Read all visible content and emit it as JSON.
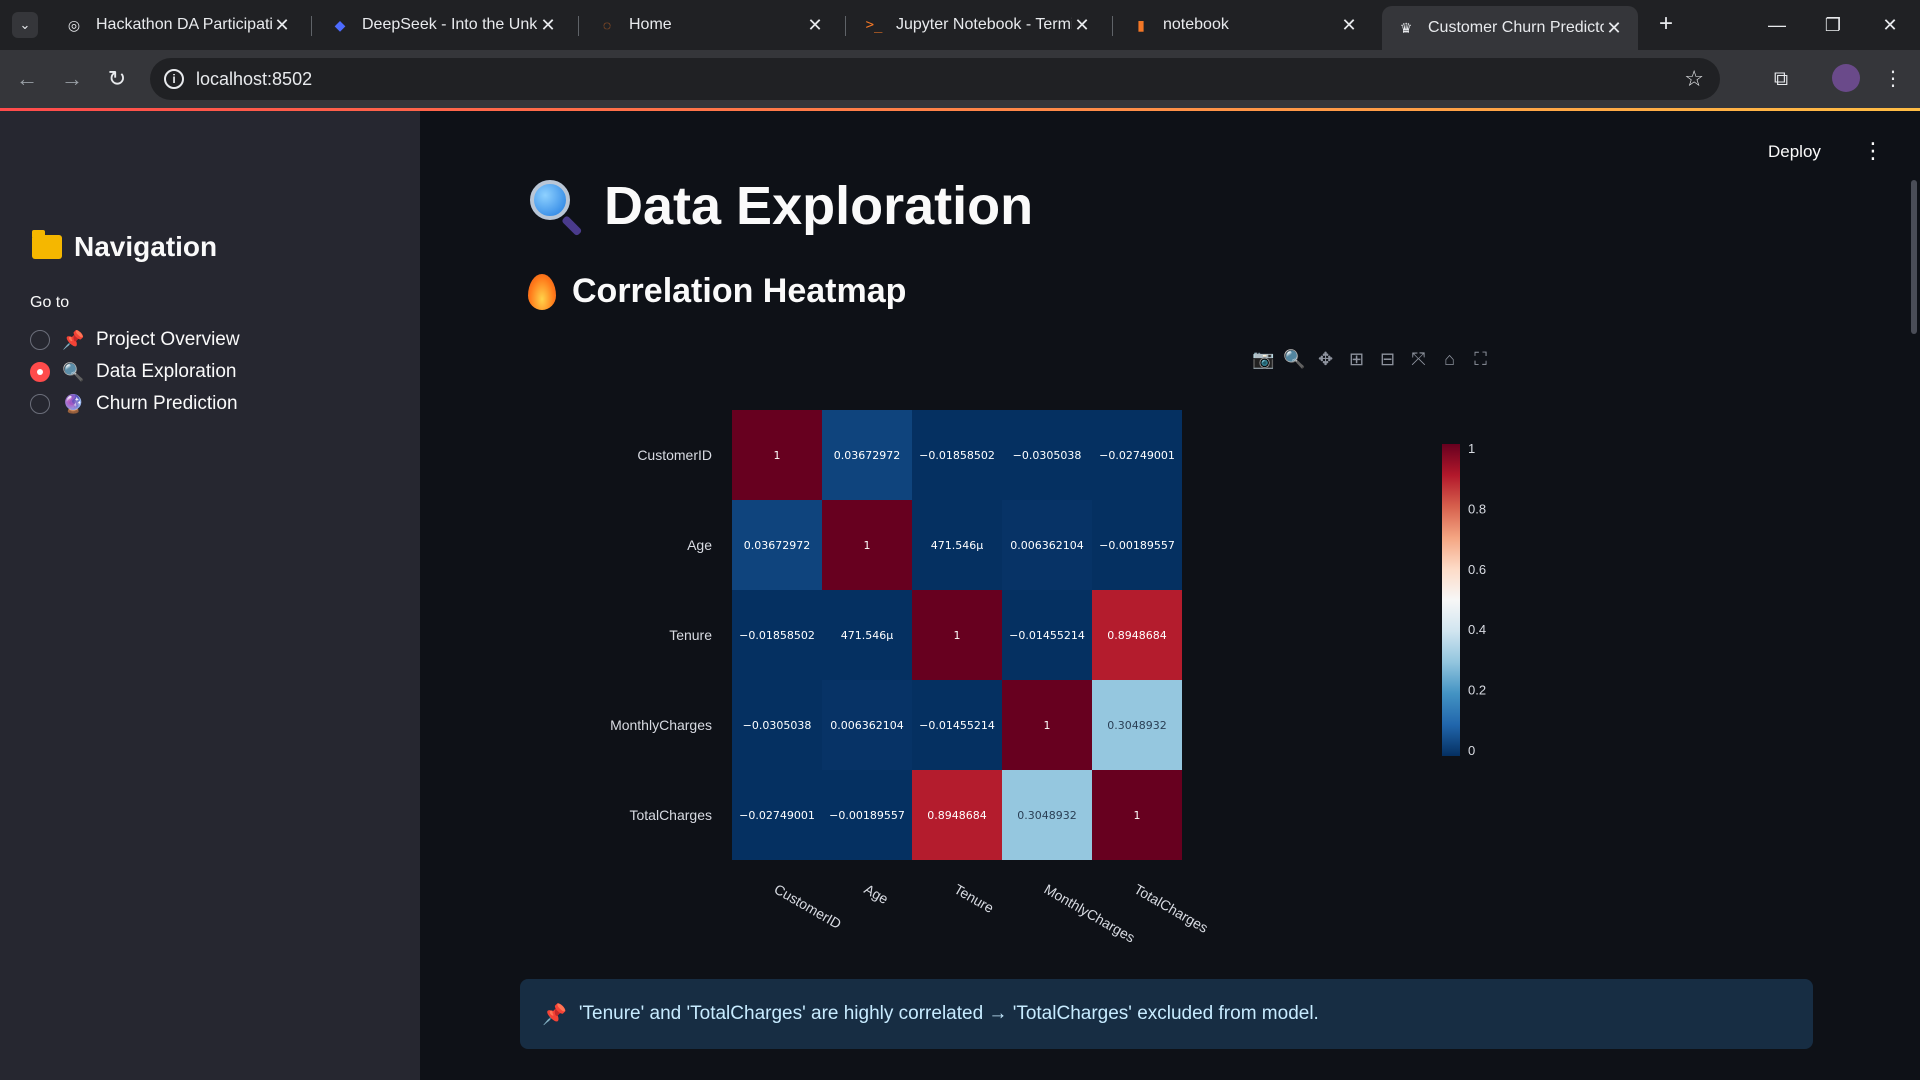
{
  "browser": {
    "tabs": [
      {
        "title": "Hackathon DA Participatio",
        "icon": "openai-icon"
      },
      {
        "title": "DeepSeek - Into the Unkno",
        "icon": "deepseek-icon"
      },
      {
        "title": "Home",
        "icon": "jupyter-icon"
      },
      {
        "title": "Jupyter Notebook - Termin",
        "icon": "terminal-icon"
      },
      {
        "title": "notebook",
        "icon": "notebook-icon"
      },
      {
        "title": "Customer Churn Predictor",
        "icon": "streamlit-icon",
        "active": true
      }
    ],
    "url": "localhost:8502"
  },
  "sidebar": {
    "heading": "Navigation",
    "goto_label": "Go to",
    "items": [
      {
        "label": "Project Overview",
        "emoji": "📌",
        "selected": false
      },
      {
        "label": "Data Exploration",
        "emoji": "🔍",
        "selected": true
      },
      {
        "label": "Churn Prediction",
        "emoji": "🔮",
        "selected": false
      }
    ]
  },
  "header": {
    "deploy_label": "Deploy"
  },
  "main": {
    "title": "Data Exploration",
    "section_title": "Correlation Heatmap",
    "note": "'Tenure' and 'TotalCharges' are highly correlated → 'TotalCharges' excluded from model."
  },
  "colors": {
    "accent": "#ff4b4b",
    "info_bg": "#172d43",
    "info_text": "#c7ebff"
  },
  "chart_data": {
    "type": "heatmap",
    "x": [
      "CustomerID",
      "Age",
      "Tenure",
      "MonthlyCharges",
      "TotalCharges"
    ],
    "y": [
      "CustomerID",
      "Age",
      "Tenure",
      "MonthlyCharges",
      "TotalCharges"
    ],
    "z": [
      [
        1,
        0.03672972,
        -0.01858502,
        -0.0305038,
        -0.02749001
      ],
      [
        0.03672972,
        1,
        0.000471546,
        0.006362104,
        -0.00189557
      ],
      [
        -0.01858502,
        0.000471546,
        1,
        -0.01455214,
        0.8948684
      ],
      [
        -0.0305038,
        0.006362104,
        -0.01455214,
        1,
        0.3048932
      ],
      [
        -0.02749001,
        -0.00189557,
        0.8948684,
        0.3048932,
        1
      ]
    ],
    "text": [
      [
        "1",
        "0.03672972",
        "−0.01858502",
        "−0.0305038",
        "−0.02749001"
      ],
      [
        "0.03672972",
        "1",
        "471.546µ",
        "0.006362104",
        "−0.00189557"
      ],
      [
        "−0.01858502",
        "471.546µ",
        "1",
        "−0.01455214",
        "0.8948684"
      ],
      [
        "−0.0305038",
        "0.006362104",
        "−0.01455214",
        "1",
        "0.3048932"
      ],
      [
        "−0.02749001",
        "−0.00189557",
        "0.8948684",
        "0.3048932",
        "1"
      ]
    ],
    "colorscale": "RdBu_r",
    "zrange": [
      0,
      1
    ],
    "colorbar_ticks": [
      "0",
      "0.2",
      "0.4",
      "0.6",
      "0.8",
      "1"
    ]
  }
}
